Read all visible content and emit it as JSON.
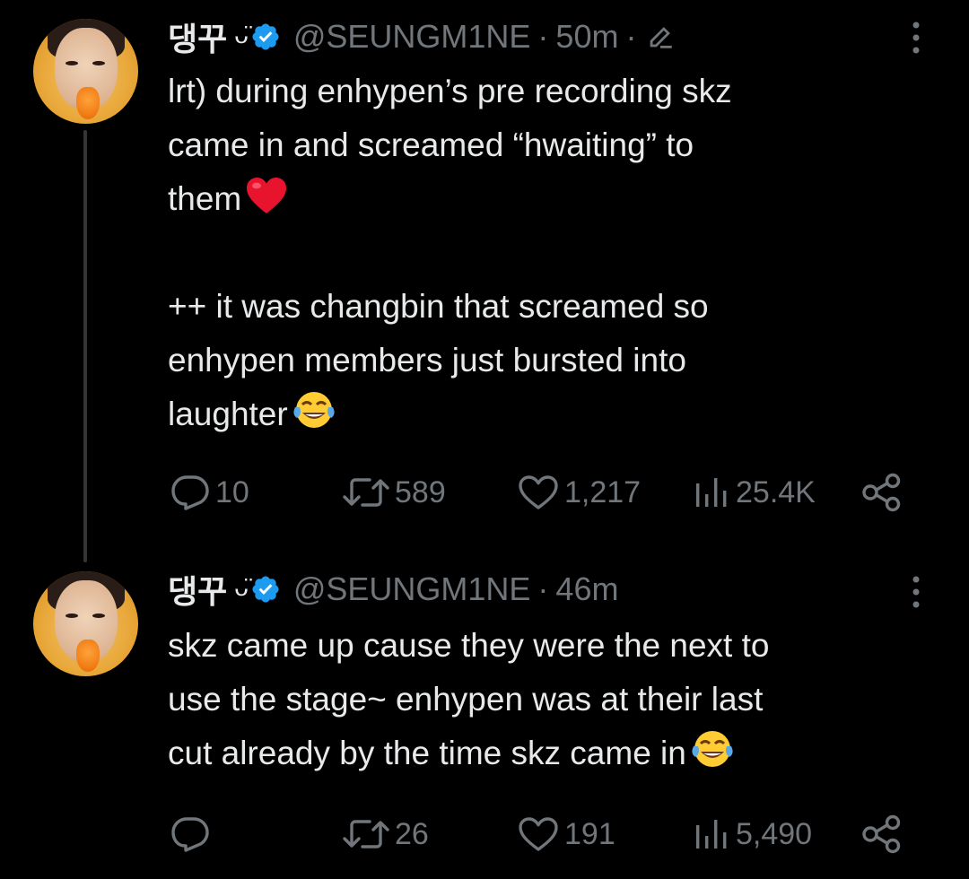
{
  "tweets": [
    {
      "display_name": "댕꾸",
      "name_decoration": "ᴗ̈",
      "handle": "@SEUNGM1NE",
      "separator": "·",
      "time": "50m",
      "edited": true,
      "paragraphs": [
        "lrt) during enhypen’s pre recording skz\ncame in and screamed “hwaiting” to\nthem",
        "++ it was changbin that screamed so\nenhypen members just bursted into\nlaughter"
      ],
      "paragraph_emojis": [
        "red-heart",
        "face-with-tears-of-joy"
      ],
      "replies": "10",
      "retweets": "589",
      "likes": "1,217",
      "views": "25.4K"
    },
    {
      "display_name": "댕꾸",
      "name_decoration": "ᴗ̈",
      "handle": "@SEUNGM1NE",
      "separator": "·",
      "time": "46m",
      "edited": false,
      "paragraphs": [
        "skz came up cause they were the next to\nuse the stage~ enhypen was at their last\ncut already by the time skz came in"
      ],
      "paragraph_emojis": [
        "face-with-tears-of-joy"
      ],
      "replies": "",
      "retweets": "26",
      "likes": "191",
      "views": "5,490"
    }
  ],
  "colors": {
    "background": "#000000",
    "primary_text": "#e7e9ea",
    "secondary_text": "#71767b",
    "verified_badge": "#1d9bf0",
    "thread_line": "#333639",
    "avatar_bg": "#e9a83a"
  },
  "icons": {
    "verified": "verified-badge-icon",
    "edit": "edit-pencil-icon",
    "more": "more-vertical-icon",
    "reply": "reply-bubble-icon",
    "retweet": "retweet-icon",
    "like": "heart-icon",
    "views": "views-bar-chart-icon",
    "share": "share-icon"
  }
}
